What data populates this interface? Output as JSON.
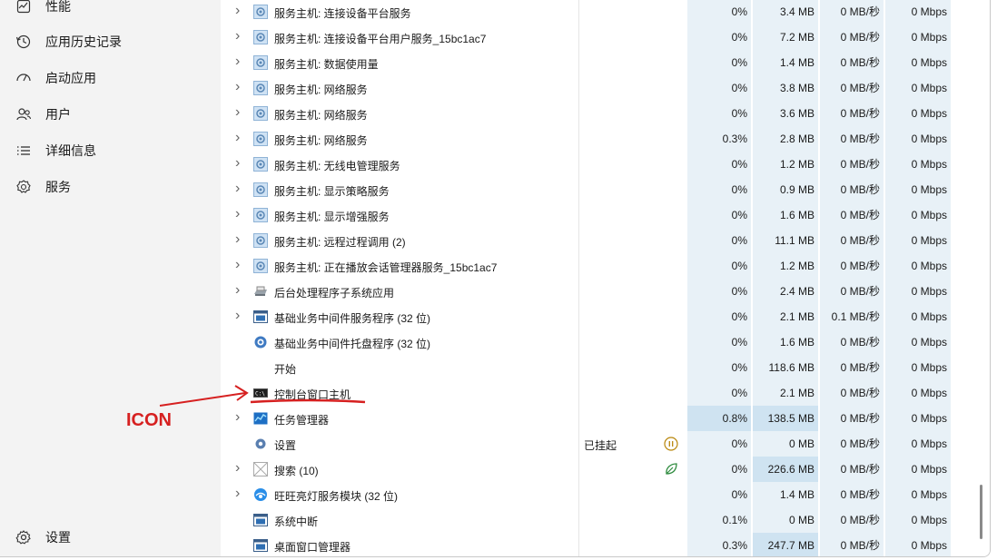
{
  "sidebar": {
    "items": [
      {
        "label": "性能",
        "icon": "performance-icon"
      },
      {
        "label": "应用历史记录",
        "icon": "history-icon"
      },
      {
        "label": "启动应用",
        "icon": "startup-icon"
      },
      {
        "label": "用户",
        "icon": "users-icon"
      },
      {
        "label": "详细信息",
        "icon": "details-icon"
      },
      {
        "label": "服务",
        "icon": "services-icon"
      }
    ],
    "settings_label": "设置"
  },
  "processes": [
    {
      "name": "服务主机: 连接设备平台服务",
      "icon": "service-host-icon",
      "expandable": true,
      "cpu": "0%",
      "mem": "3.4 MB",
      "disk": "0 MB/秒",
      "net": "0 Mbps"
    },
    {
      "name": "服务主机: 连接设备平台用户服务_15bc1ac7",
      "icon": "service-host-icon",
      "expandable": true,
      "cpu": "0%",
      "mem": "7.2 MB",
      "disk": "0 MB/秒",
      "net": "0 Mbps"
    },
    {
      "name": "服务主机: 数据使用量",
      "icon": "service-host-icon",
      "expandable": true,
      "cpu": "0%",
      "mem": "1.4 MB",
      "disk": "0 MB/秒",
      "net": "0 Mbps"
    },
    {
      "name": "服务主机: 网络服务",
      "icon": "service-host-icon",
      "expandable": true,
      "cpu": "0%",
      "mem": "3.8 MB",
      "disk": "0 MB/秒",
      "net": "0 Mbps"
    },
    {
      "name": "服务主机: 网络服务",
      "icon": "service-host-icon",
      "expandable": true,
      "cpu": "0%",
      "mem": "3.6 MB",
      "disk": "0 MB/秒",
      "net": "0 Mbps"
    },
    {
      "name": "服务主机: 网络服务",
      "icon": "service-host-icon",
      "expandable": true,
      "cpu": "0.3%",
      "mem": "2.8 MB",
      "disk": "0 MB/秒",
      "net": "0 Mbps"
    },
    {
      "name": "服务主机: 无线电管理服务",
      "icon": "service-host-icon",
      "expandable": true,
      "cpu": "0%",
      "mem": "1.2 MB",
      "disk": "0 MB/秒",
      "net": "0 Mbps"
    },
    {
      "name": "服务主机: 显示策略服务",
      "icon": "service-host-icon",
      "expandable": true,
      "cpu": "0%",
      "mem": "0.9 MB",
      "disk": "0 MB/秒",
      "net": "0 Mbps"
    },
    {
      "name": "服务主机: 显示增强服务",
      "icon": "service-host-icon",
      "expandable": true,
      "cpu": "0%",
      "mem": "1.6 MB",
      "disk": "0 MB/秒",
      "net": "0 Mbps"
    },
    {
      "name": "服务主机: 远程过程调用 (2)",
      "icon": "service-host-icon",
      "expandable": true,
      "cpu": "0%",
      "mem": "11.1 MB",
      "disk": "0 MB/秒",
      "net": "0 Mbps"
    },
    {
      "name": "服务主机: 正在播放会话管理器服务_15bc1ac7",
      "icon": "service-host-icon",
      "expandable": true,
      "cpu": "0%",
      "mem": "1.2 MB",
      "disk": "0 MB/秒",
      "net": "0 Mbps"
    },
    {
      "name": "后台处理程序子系统应用",
      "icon": "printer-icon",
      "expandable": true,
      "cpu": "0%",
      "mem": "2.4 MB",
      "disk": "0 MB/秒",
      "net": "0 Mbps"
    },
    {
      "name": "基础业务中间件服务程序 (32 位)",
      "icon": "app-window-icon",
      "expandable": true,
      "cpu": "0%",
      "mem": "2.1 MB",
      "disk": "0.1 MB/秒",
      "net": "0 Mbps"
    },
    {
      "name": "基础业务中间件托盘程序 (32 位)",
      "icon": "gear-app-icon",
      "expandable": false,
      "cpu": "0%",
      "mem": "1.6 MB",
      "disk": "0 MB/秒",
      "net": "0 Mbps"
    },
    {
      "name": "开始",
      "icon": "",
      "expandable": false,
      "cpu": "0%",
      "mem": "118.6 MB",
      "disk": "0 MB/秒",
      "net": "0 Mbps"
    },
    {
      "name": "控制台窗口主机",
      "icon": "console-icon",
      "expandable": false,
      "cpu": "0%",
      "mem": "2.1 MB",
      "disk": "0 MB/秒",
      "net": "0 Mbps"
    },
    {
      "name": "任务管理器",
      "icon": "task-manager-icon",
      "expandable": true,
      "cpu": "0.8%",
      "mem": "138.5 MB",
      "disk": "0 MB/秒",
      "net": "0 Mbps",
      "hl_cpu": true,
      "hl_mem": true
    },
    {
      "name": "设置",
      "icon": "settings-gear-icon",
      "expandable": false,
      "status": "已挂起",
      "efficiency": "paused",
      "cpu": "0%",
      "mem": "0 MB",
      "disk": "0 MB/秒",
      "net": "0 Mbps"
    },
    {
      "name": "搜索 (10)",
      "icon": "search-app-icon",
      "expandable": true,
      "efficiency": "leaf",
      "cpu": "0%",
      "mem": "226.6 MB",
      "disk": "0 MB/秒",
      "net": "0 Mbps",
      "hl_mem": true
    },
    {
      "name": "旺旺亮灯服务模块 (32 位)",
      "icon": "blue-globe-icon",
      "expandable": true,
      "cpu": "0%",
      "mem": "1.4 MB",
      "disk": "0 MB/秒",
      "net": "0 Mbps"
    },
    {
      "name": "系统中断",
      "icon": "app-window-icon",
      "expandable": false,
      "cpu": "0.1%",
      "mem": "0 MB",
      "disk": "0 MB/秒",
      "net": "0 Mbps"
    },
    {
      "name": "桌面窗口管理器",
      "icon": "app-window-icon",
      "expandable": false,
      "cpu": "0.3%",
      "mem": "247.7 MB",
      "disk": "0 MB/秒",
      "net": "0 Mbps",
      "hl_mem": true
    }
  ],
  "annotation": {
    "text": "ICON",
    "color": "#d62020"
  }
}
